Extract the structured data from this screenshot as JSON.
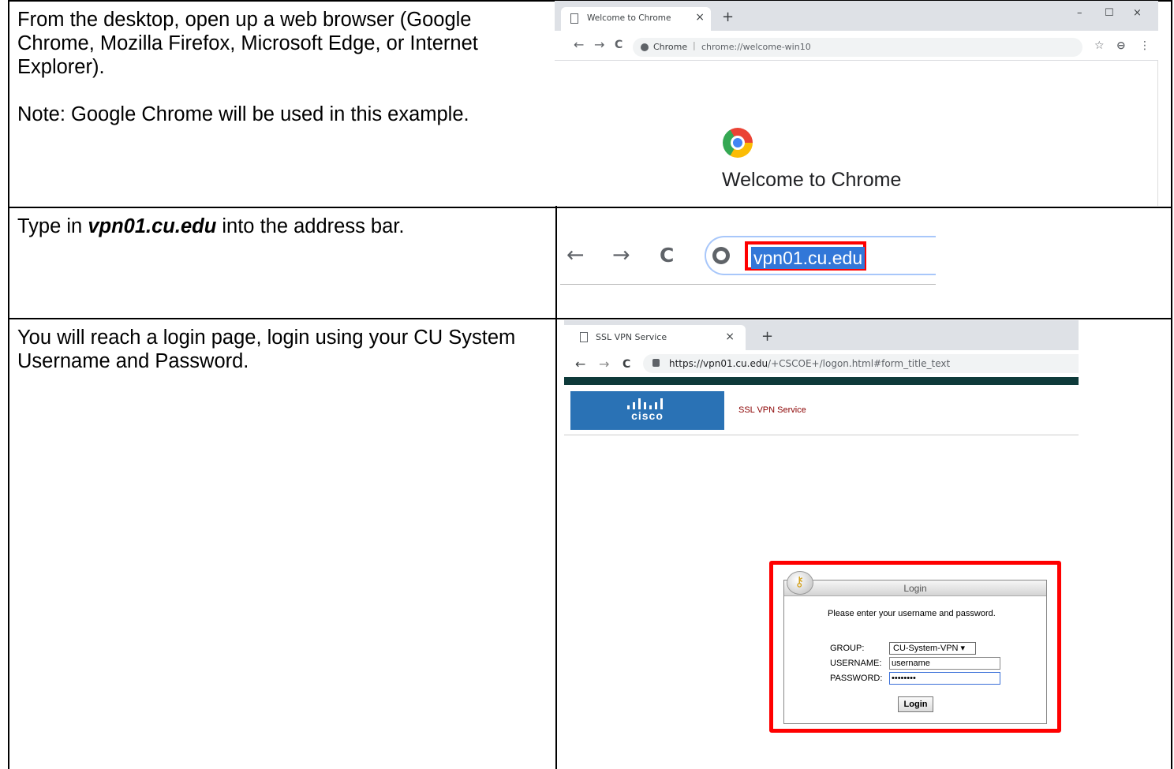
{
  "rows": [
    {
      "paragraphs": [
        "From the desktop, open up a web browser (Google Chrome, Mozilla Firefox, Microsoft Edge, or Internet Explorer).",
        "Note: Google Chrome will be used in this example."
      ]
    },
    {
      "prefix": "Type in ",
      "emphasis": "vpn01.cu.edu",
      "suffix": " into the address bar."
    },
    {
      "paragraphs": [
        "You will reach a login page, login using your CU System Username and Password."
      ]
    }
  ],
  "shot1": {
    "tab_title": "Welcome to Chrome",
    "tab_close": "×",
    "new_tab": "+",
    "win_min": "–",
    "win_max": "☐",
    "win_close": "×",
    "back": "←",
    "forward": "→",
    "reload": "C",
    "site_label": "Chrome",
    "separator": "|",
    "url": "chrome://welcome-win10",
    "star": "☆",
    "profile": "⊖",
    "menu": "⋮",
    "heading": "Welcome to Chrome"
  },
  "shot2": {
    "back": "←",
    "forward": "→",
    "reload": "C",
    "url": "vpn01.cu.edu"
  },
  "shot3": {
    "tab_title": "SSL VPN Service",
    "tab_close": "×",
    "new_tab": "+",
    "back": "←",
    "forward": "→",
    "reload": "C",
    "url_host": "https://vpn01.cu.edu",
    "url_path": "/+CSCOE+/logon.html#form_title_text",
    "brand": "cisco",
    "service_name": "SSL VPN Service",
    "login_title": "Login",
    "prompt": "Please enter your username and password.",
    "group_label": "GROUP:",
    "group_value": "CU-System-VPN ▾",
    "username_label": "USERNAME:",
    "username_value": "username",
    "password_label": "PASSWORD:",
    "password_value": "••••••••",
    "login_button": "Login"
  },
  "colors": {
    "highlight_box": "#ff0000",
    "selection": "#3277d8",
    "cisco_blue": "#2a72b5",
    "service_text": "#8b0000"
  }
}
